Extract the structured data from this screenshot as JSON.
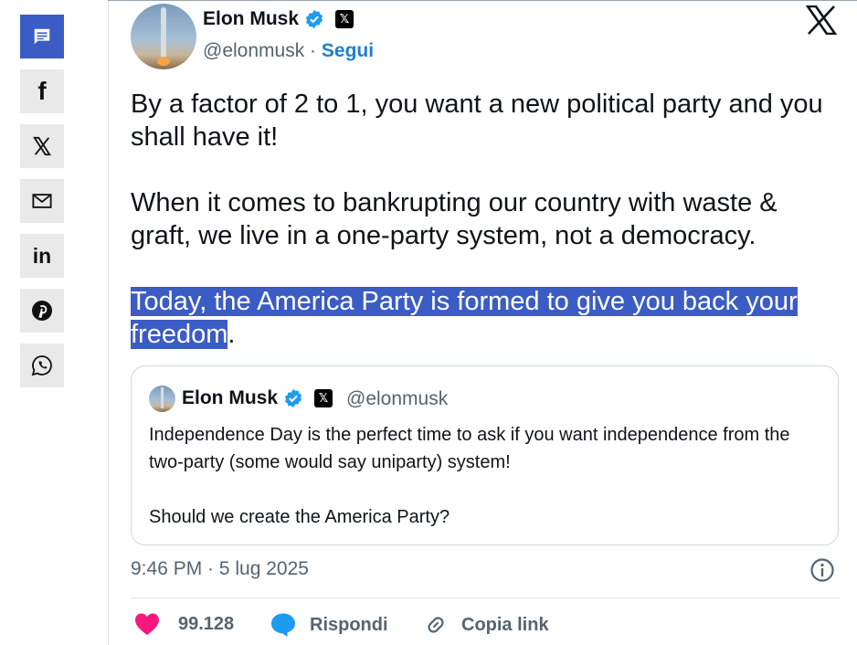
{
  "share_sidebar": {
    "buttons": [
      {
        "icon": "comment-icon",
        "active": true
      },
      {
        "icon": "facebook-icon",
        "glyph": "f"
      },
      {
        "icon": "x-icon"
      },
      {
        "icon": "mail-icon"
      },
      {
        "icon": "linkedin-icon",
        "glyph": "in"
      },
      {
        "icon": "pinterest-icon"
      },
      {
        "icon": "whatsapp-icon"
      }
    ]
  },
  "tweet": {
    "author_name": "Elon Musk",
    "handle": "@elonmusk",
    "separator": "·",
    "follow_label": "Segui",
    "paragraph1": "By a factor of 2 to 1, you want a new political party and you shall have it!",
    "paragraph2": "When it comes to bankrupting our country with waste & graft, we live in a one-party system, not a democracy.",
    "paragraph3_highlighted": "Today, the America Party is formed to give you back your freedom",
    "paragraph3_tail": ".",
    "timestamp": "9:46 PM · 5 lug 2025",
    "likes_count": "99.128",
    "reply_label": "Rispondi",
    "copy_link_label": "Copia link"
  },
  "quoted_tweet": {
    "author_name": "Elon Musk",
    "handle": "@elonmusk",
    "paragraph1": "Independence Day is the perfect time to ask if you want independence from the two-party (some would say uniparty) system!",
    "paragraph2": "Should we create the America Party?"
  },
  "colors": {
    "accent": "#3b5cc4",
    "link": "#1d7fcf",
    "verified": "#1d9bf0",
    "like": "#f91880",
    "muted": "#536471"
  }
}
